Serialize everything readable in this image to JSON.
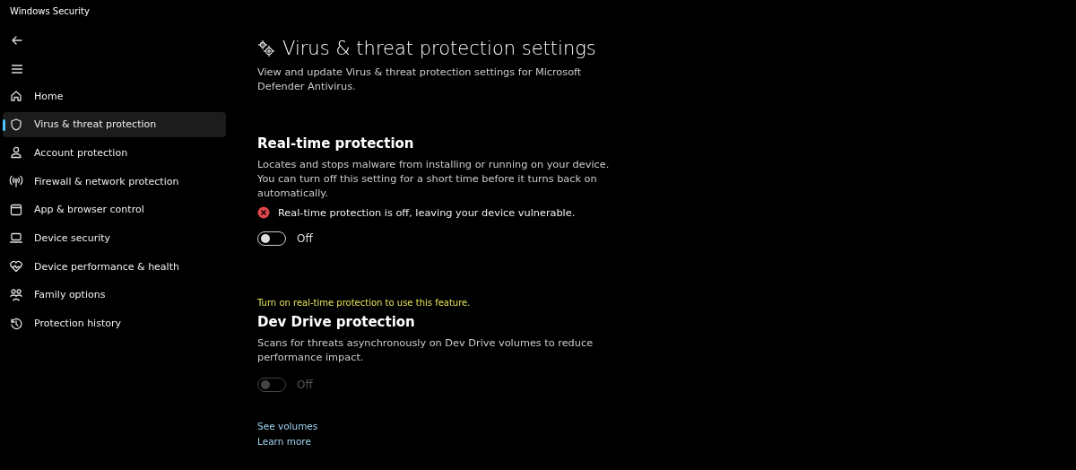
{
  "window": {
    "title": "Windows Security"
  },
  "sidebar": {
    "items": [
      {
        "label": "Home",
        "selected": false
      },
      {
        "label": "Virus & threat protection",
        "selected": true
      },
      {
        "label": "Account protection",
        "selected": false
      },
      {
        "label": "Firewall & network protection",
        "selected": false
      },
      {
        "label": "App & browser control",
        "selected": false
      },
      {
        "label": "Device security",
        "selected": false
      },
      {
        "label": "Device performance & health",
        "selected": false
      },
      {
        "label": "Family options",
        "selected": false
      },
      {
        "label": "Protection history",
        "selected": false
      }
    ]
  },
  "page": {
    "title": "Virus & threat protection settings",
    "description": "View and update Virus & threat protection settings for Microsoft Defender Antivirus."
  },
  "sections": [
    {
      "heading": "Real-time protection",
      "description": "Locates and stops malware from installing or running on your device. You can turn off this setting for a short time before it turns back on automatically.",
      "status": {
        "kind": "error",
        "text": "Real-time protection is off, leaving your device vulnerable."
      },
      "toggle": {
        "on": false,
        "disabled": false,
        "label": "Off"
      }
    },
    {
      "notice": "Turn on real-time protection to use this feature.",
      "heading": "Dev Drive protection",
      "description": "Scans for threats asynchronously on Dev Drive volumes to reduce performance impact.",
      "toggle": {
        "on": false,
        "disabled": true,
        "label": "Off"
      },
      "links": [
        "See volumes",
        "Learn more"
      ]
    }
  ]
}
